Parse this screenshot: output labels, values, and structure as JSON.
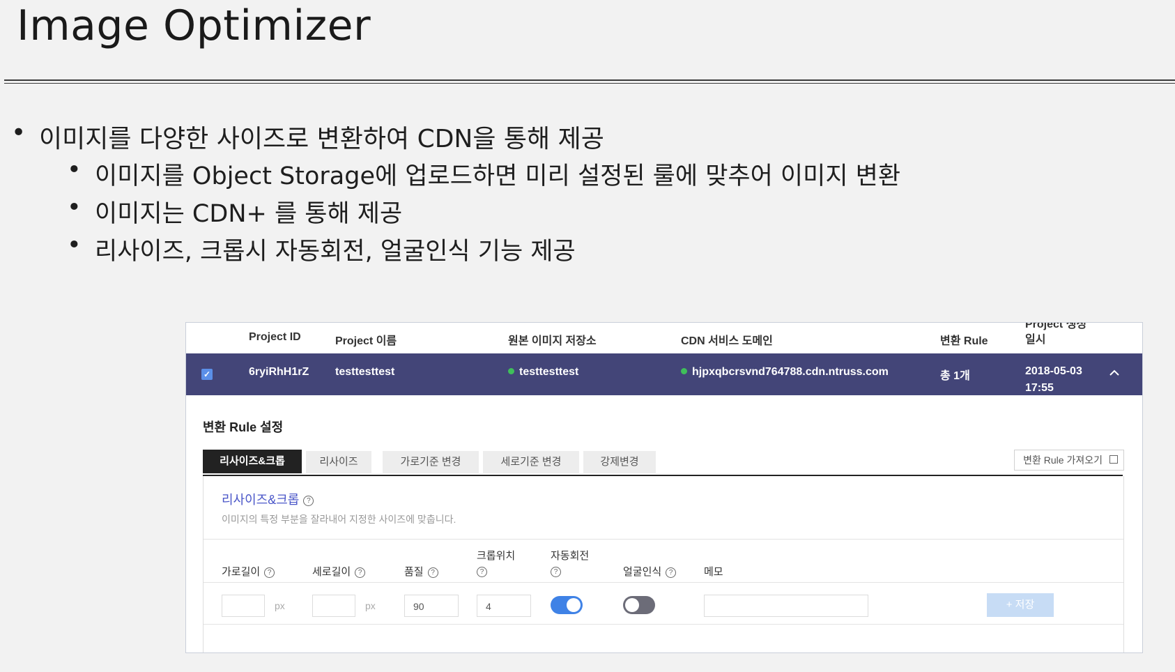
{
  "slide": {
    "title": "Image Optimizer",
    "bullets": [
      "이미지를 다양한 사이즈로 변환하여 CDN을 통해 제공",
      "이미지를 Object Storage에 업로드하면 미리 설정된 룰에 맞추어 이미지 변환",
      "이미지는 CDN+ 를 통해 제공",
      "리사이즈, 크롭시 자동회전, 얼굴인식 기능 제공"
    ],
    "bullet_glyph": "•"
  },
  "table": {
    "headers": {
      "project_id": "Project ID",
      "project_name": "Project 이름",
      "origin_storage": "원본 이미지 저장소",
      "cdn_domain": "CDN 서비스 도메인",
      "rule": "변환 Rule",
      "created_line1": "Project 생성",
      "created_line2": "일시"
    },
    "row": {
      "checked": true,
      "project_id": "6ryiRhH1rZ",
      "project_name": "testtesttest",
      "origin_storage": "testtesttest",
      "cdn_domain": "hjpxqbcrsvnd764788.cdn.ntruss.com",
      "rule": "총 1개",
      "created_date": "2018-05-03",
      "created_time": "17:55"
    }
  },
  "rule_settings": {
    "title": "변환 Rule 설정",
    "tabs": [
      "리사이즈&크롭",
      "리사이즈",
      "가로기준 변경",
      "세로기준 변경",
      "강제변경"
    ],
    "active_tab": 0,
    "import_button": "변환 Rule 가져오기",
    "panel_title": "리사이즈&크롭",
    "panel_desc": "이미지의 특정 부분을 잘라내어 지정한 사이즈에 맞춥니다.",
    "fields": {
      "width_label": "가로길이",
      "height_label": "세로길이",
      "quality_label": "품질",
      "crop_pos_label": "크롭위치",
      "auto_rotate_label": "자동회전",
      "face_detect_label": "얼굴인식",
      "memo_label": "메모",
      "width_value": "",
      "height_value": "",
      "quality_value": "90",
      "crop_pos_value": "4",
      "memo_value": "",
      "unit": "px",
      "help_glyph": "?",
      "auto_rotate_on": true,
      "face_detect_on": false
    },
    "save_button": "+ 저장"
  },
  "colors": {
    "selected_row": "#434578",
    "accent_blue": "#3f82e6",
    "status_green": "#3fbf5a",
    "panel_title": "#4a56c8"
  }
}
